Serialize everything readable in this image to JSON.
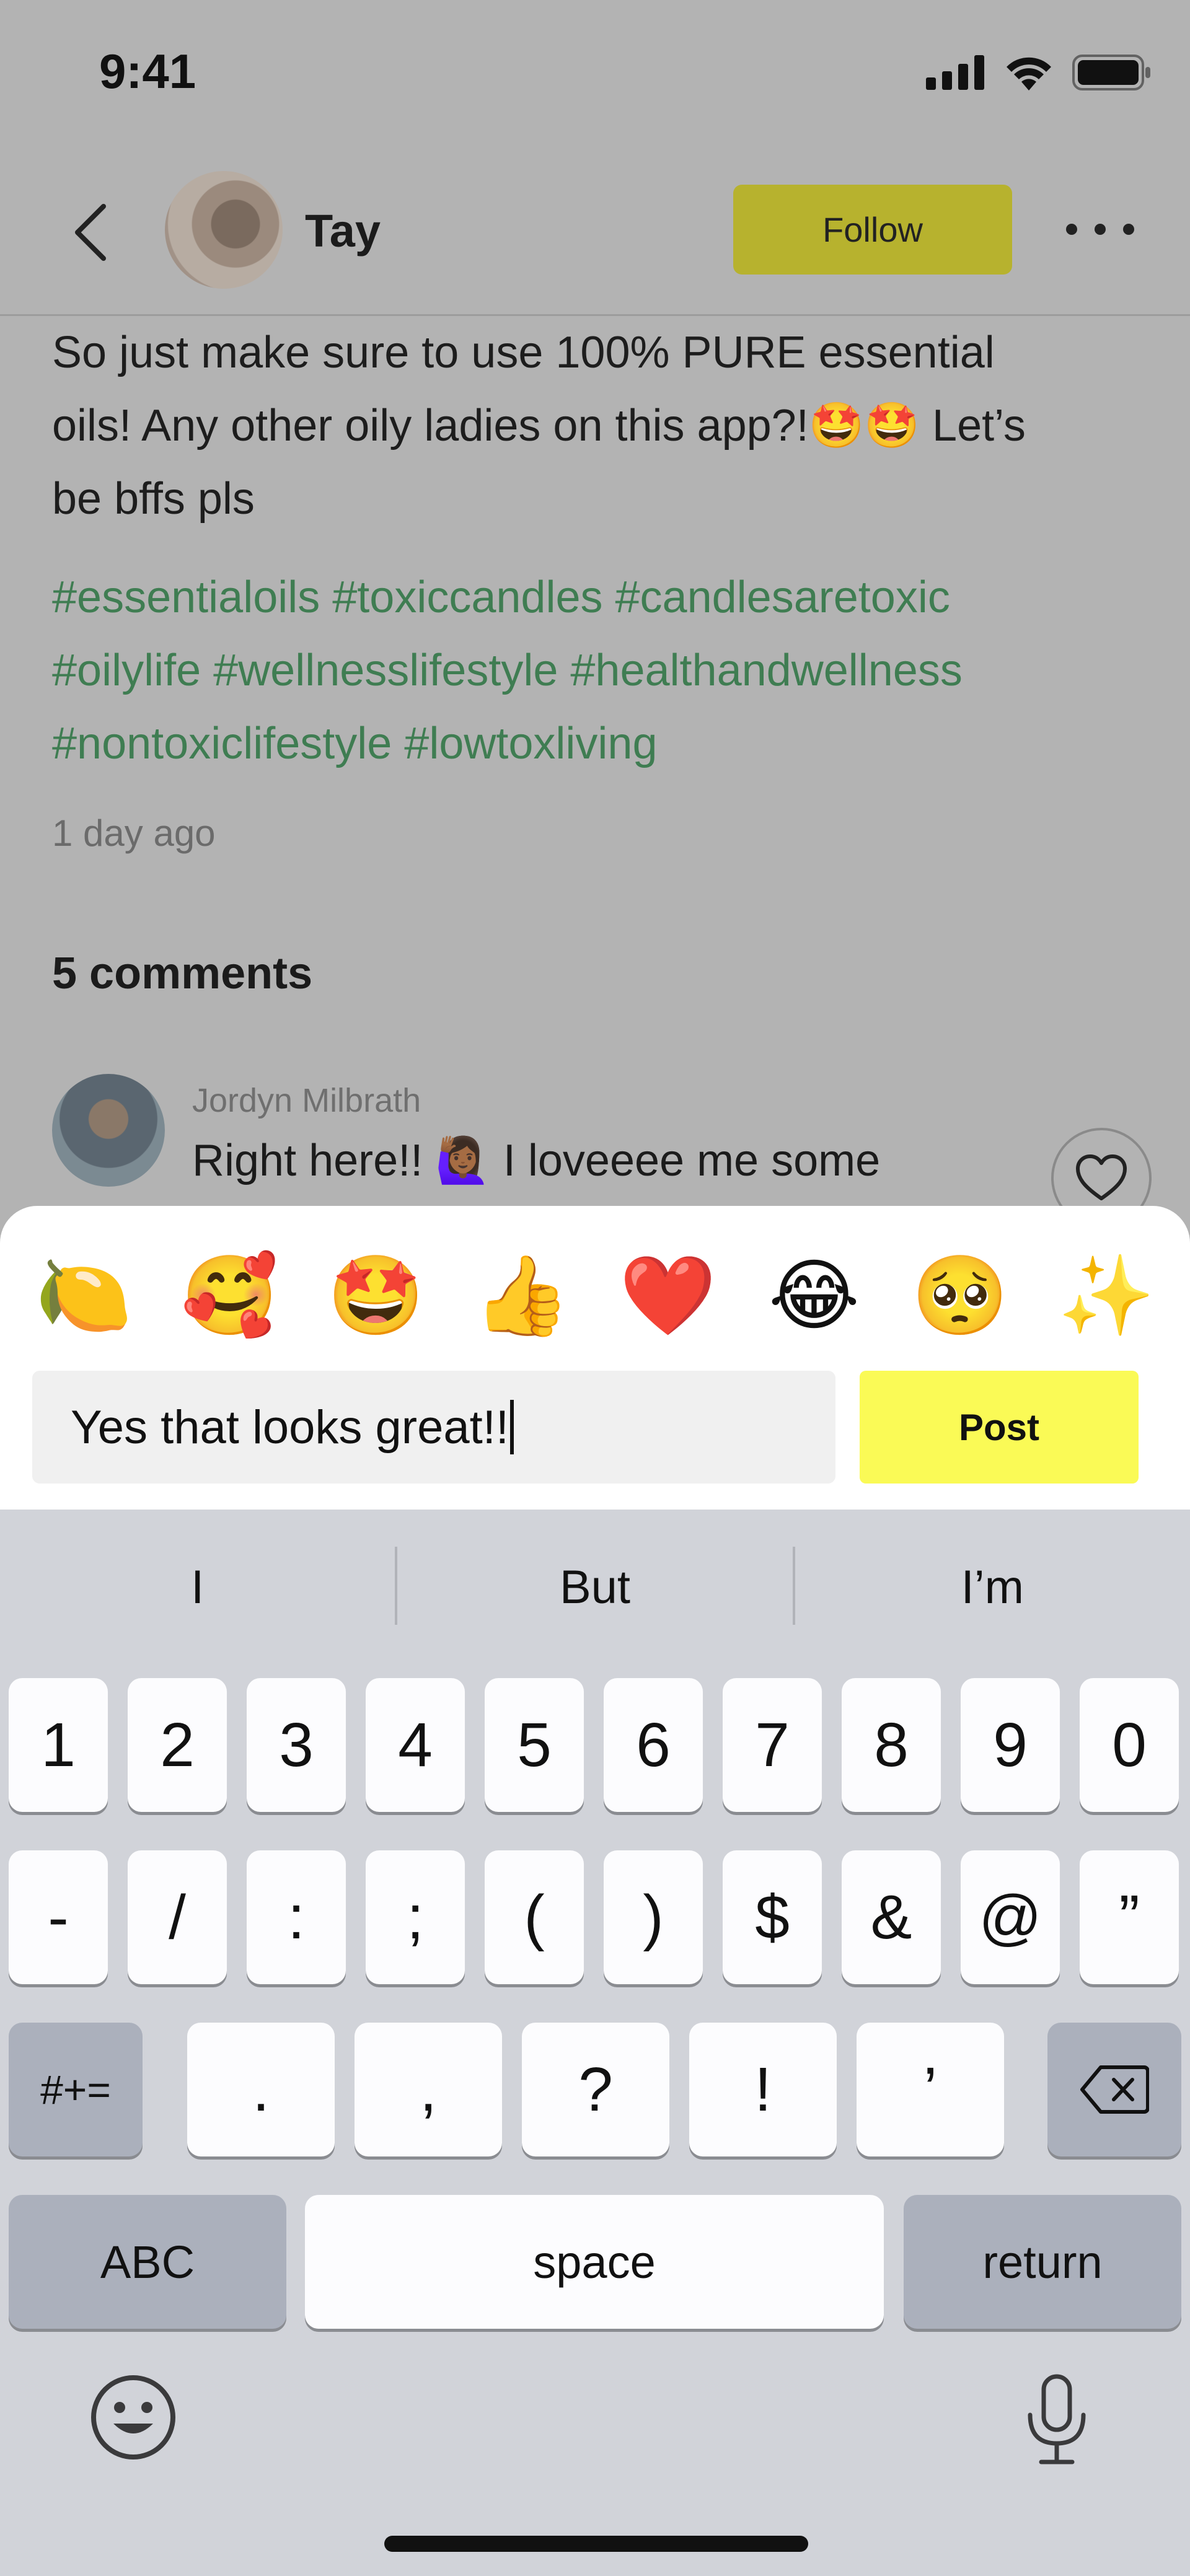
{
  "status_bar": {
    "time": "9:41"
  },
  "header": {
    "username": "Tay",
    "follow_label": "Follow"
  },
  "post": {
    "body_lines": [
      "So just make sure to use 100% PURE essential",
      "oils! Any other oily ladies on this app?!🤩🤩 Let’s",
      "be bffs pls"
    ],
    "hashtag_lines": [
      "#essentialoils #toxiccandles #candlesaretoxic",
      "#oilylife #wellnesslifestyle #healthandwellness",
      "#nontoxiclifestyle #lowtoxliving"
    ],
    "time_ago": "1 day ago"
  },
  "comments": {
    "count_label": "5 comments",
    "items": [
      {
        "author": "Jordyn Milbrath",
        "text": "Right here!! 🙋🏾‍♀️ I loveeee me some"
      }
    ]
  },
  "composer": {
    "emojis": [
      "🍋",
      "🥰",
      "🤩",
      "👍",
      "❤️",
      "😂",
      "🥺",
      "✨"
    ],
    "input_value": "Yes that looks great!!",
    "post_label": "Post"
  },
  "keyboard": {
    "suggestions": [
      "I",
      "But",
      "I’m"
    ],
    "row1": [
      "1",
      "2",
      "3",
      "4",
      "5",
      "6",
      "7",
      "8",
      "9",
      "0"
    ],
    "row2": [
      "-",
      "/",
      ":",
      ";",
      "(",
      ")",
      "$",
      "&",
      "@",
      "”"
    ],
    "row3": [
      ".",
      ",",
      "?",
      "!",
      "’"
    ],
    "symbols_label": "#+=",
    "abc_label": "ABC",
    "space_label": "space",
    "return_label": "return"
  }
}
